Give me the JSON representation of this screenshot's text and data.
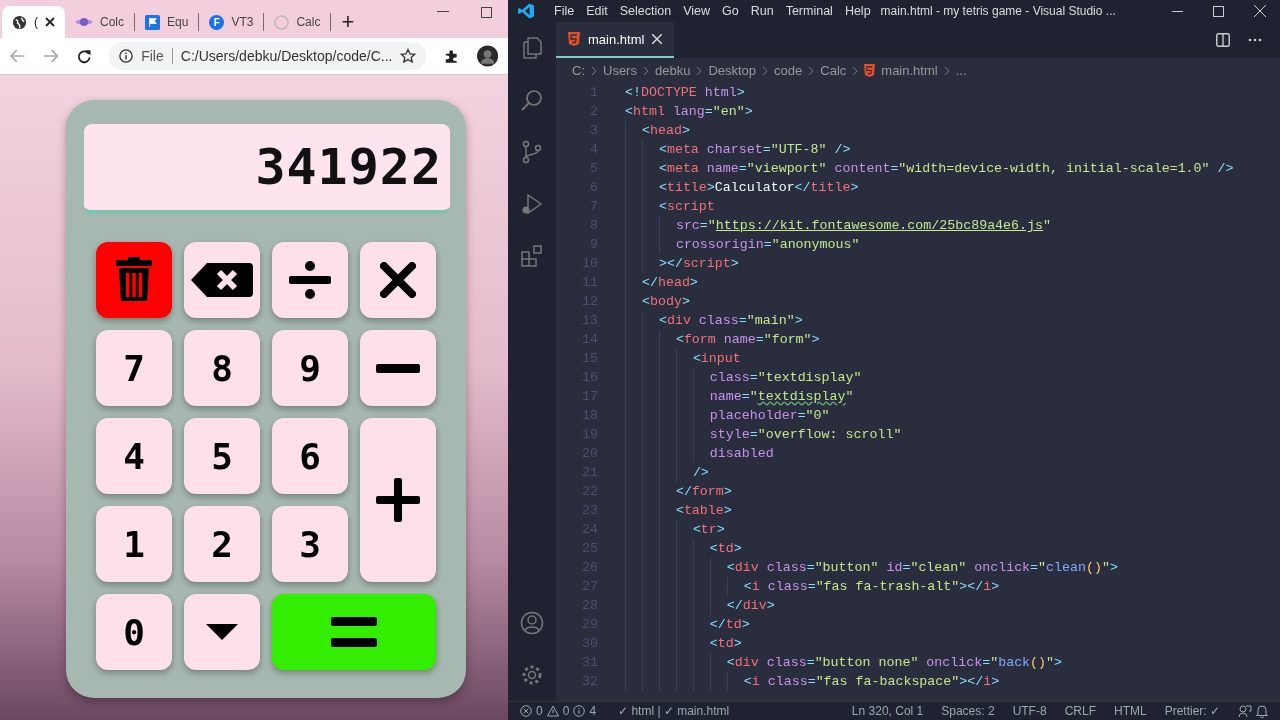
{
  "browser": {
    "tabs": [
      {
        "kind": "globe",
        "label": "(",
        "selected": true
      },
      {
        "kind": "planet",
        "label": "Colc",
        "selected": false
      },
      {
        "kind": "flag",
        "label": "Equ",
        "selected": false
      },
      {
        "kind": "letter",
        "letter": "F",
        "label": "VT3",
        "selected": false
      },
      {
        "kind": "github",
        "label": "Calc",
        "selected": false
      }
    ],
    "new_tab": "+",
    "address": {
      "scheme": "File",
      "url": "C:/Users/debku/Desktop/code/C..."
    }
  },
  "calculator": {
    "display": "341922",
    "buttons": [
      {
        "kind": "trash",
        "color": "#ff0000"
      },
      {
        "kind": "backspace",
        "color": "#fde0ea"
      },
      {
        "kind": "divide",
        "color": "#fde0ea"
      },
      {
        "kind": "times",
        "color": "#fde0ea"
      },
      {
        "kind": "digit",
        "label": "7",
        "color": "#fde0ea"
      },
      {
        "kind": "digit",
        "label": "8",
        "color": "#fde0ea"
      },
      {
        "kind": "digit",
        "label": "9",
        "color": "#fde0ea"
      },
      {
        "kind": "minus",
        "color": "#fde0ea"
      },
      {
        "kind": "digit",
        "label": "4",
        "color": "#fde0ea"
      },
      {
        "kind": "digit",
        "label": "5",
        "color": "#fde0ea"
      },
      {
        "kind": "digit",
        "label": "6",
        "color": "#fde0ea"
      },
      {
        "kind": "plus",
        "color": "#fde0ea"
      },
      {
        "kind": "digit",
        "label": "1",
        "color": "#fde0ea"
      },
      {
        "kind": "digit",
        "label": "2",
        "color": "#fde0ea"
      },
      {
        "kind": "digit",
        "label": "3",
        "color": "#fde0ea"
      },
      {
        "kind": "digit",
        "label": "0",
        "color": "#fde0ea"
      },
      {
        "kind": "caret",
        "color": "#fde0ea"
      },
      {
        "kind": "equals",
        "color": "#33ee00"
      }
    ]
  },
  "editor": {
    "menu": [
      "File",
      "Edit",
      "Selection",
      "View",
      "Go",
      "Run",
      "Terminal",
      "Help"
    ],
    "title": "main.html - my tetris game - Visual Studio ...",
    "tab": {
      "label": "main.html"
    },
    "breadcrumbs": [
      {
        "label": "C:"
      },
      {
        "label": "Users"
      },
      {
        "label": "debku"
      },
      {
        "label": "Desktop"
      },
      {
        "label": "code"
      },
      {
        "label": "Calc"
      },
      {
        "label": "main.html",
        "file": true
      },
      {
        "label": "..."
      }
    ],
    "lines": [
      {
        "n": "1",
        "tokens": [
          {
            "kind": "p",
            "text": "<!"
          },
          {
            "kind": "t",
            "text": "DOCTYPE"
          },
          {
            "kind": "a",
            "text": " html"
          },
          {
            "kind": "p",
            "text": ">"
          }
        ]
      },
      {
        "n": "2",
        "tokens": [
          {
            "kind": "p",
            "text": "<"
          },
          {
            "kind": "t",
            "text": "html"
          },
          {
            "kind": "a",
            "text": " lang"
          },
          {
            "kind": "p",
            "text": "="
          },
          {
            "kind": "s",
            "text": "\"en\""
          },
          {
            "kind": "p",
            "text": ">"
          }
        ]
      },
      {
        "n": "3",
        "tokens": [
          {
            "kind": "p",
            "text": "  <"
          },
          {
            "kind": "t",
            "text": "head"
          },
          {
            "kind": "p",
            "text": ">"
          }
        ]
      },
      {
        "n": "4",
        "tokens": [
          {
            "kind": "p",
            "text": "    <"
          },
          {
            "kind": "t",
            "text": "meta"
          },
          {
            "kind": "a",
            "text": " charset"
          },
          {
            "kind": "p",
            "text": "="
          },
          {
            "kind": "s",
            "text": "\"UTF-8\""
          },
          {
            "kind": "p",
            "text": " />"
          }
        ]
      },
      {
        "n": "5",
        "tokens": [
          {
            "kind": "p",
            "text": "    <"
          },
          {
            "kind": "t",
            "text": "meta"
          },
          {
            "kind": "a",
            "text": " name"
          },
          {
            "kind": "p",
            "text": "="
          },
          {
            "kind": "s",
            "text": "\"viewport\""
          },
          {
            "kind": "a",
            "text": " content"
          },
          {
            "kind": "p",
            "text": "="
          },
          {
            "kind": "s",
            "text": "\"width=device-width, initial-scale=1.0\""
          },
          {
            "kind": "p",
            "text": " />"
          }
        ]
      },
      {
        "n": "6",
        "tokens": [
          {
            "kind": "p",
            "text": "    <"
          },
          {
            "kind": "t",
            "text": "title"
          },
          {
            "kind": "p",
            "text": ">"
          },
          {
            "kind": "x",
            "text": "Calculator"
          },
          {
            "kind": "p",
            "text": "</"
          },
          {
            "kind": "t",
            "text": "title"
          },
          {
            "kind": "p",
            "text": ">"
          }
        ]
      },
      {
        "n": "7",
        "tokens": [
          {
            "kind": "p",
            "text": "    <"
          },
          {
            "kind": "t",
            "text": "script"
          }
        ]
      },
      {
        "n": "8",
        "tokens": [
          {
            "kind": "a",
            "text": "      src"
          },
          {
            "kind": "p",
            "text": "="
          },
          {
            "kind": "s",
            "text": "\""
          },
          {
            "kind": "l",
            "text": "https://kit.fontawesome.com/25bc89a4e6.js"
          },
          {
            "kind": "s",
            "text": "\""
          }
        ]
      },
      {
        "n": "9",
        "tokens": [
          {
            "kind": "a",
            "text": "      crossorigin"
          },
          {
            "kind": "p",
            "text": "="
          },
          {
            "kind": "s",
            "text": "\"anonymous\""
          }
        ]
      },
      {
        "n": "10",
        "tokens": [
          {
            "kind": "p",
            "text": "    ></"
          },
          {
            "kind": "t",
            "text": "script"
          },
          {
            "kind": "p",
            "text": ">"
          }
        ]
      },
      {
        "n": "11",
        "tokens": [
          {
            "kind": "p",
            "text": "  </"
          },
          {
            "kind": "t",
            "text": "head"
          },
          {
            "kind": "p",
            "text": ">"
          }
        ]
      },
      {
        "n": "12",
        "tokens": [
          {
            "kind": "p",
            "text": "  <"
          },
          {
            "kind": "t",
            "text": "body"
          },
          {
            "kind": "p",
            "text": ">"
          }
        ]
      },
      {
        "n": "13",
        "tokens": [
          {
            "kind": "p",
            "text": "    <"
          },
          {
            "kind": "t",
            "text": "div"
          },
          {
            "kind": "a",
            "text": " class"
          },
          {
            "kind": "p",
            "text": "="
          },
          {
            "kind": "s",
            "text": "\"main\""
          },
          {
            "kind": "p",
            "text": ">"
          }
        ]
      },
      {
        "n": "14",
        "tokens": [
          {
            "kind": "p",
            "text": "      <"
          },
          {
            "kind": "t",
            "text": "form"
          },
          {
            "kind": "a",
            "text": " name"
          },
          {
            "kind": "p",
            "text": "="
          },
          {
            "kind": "s",
            "text": "\"form\""
          },
          {
            "kind": "p",
            "text": ">"
          }
        ]
      },
      {
        "n": "15",
        "tokens": [
          {
            "kind": "p",
            "text": "        <"
          },
          {
            "kind": "t",
            "text": "input"
          }
        ]
      },
      {
        "n": "16",
        "tokens": [
          {
            "kind": "a",
            "text": "          class"
          },
          {
            "kind": "p",
            "text": "="
          },
          {
            "kind": "s",
            "text": "\"textdisplay\""
          }
        ]
      },
      {
        "n": "17",
        "tokens": [
          {
            "kind": "a",
            "text": "          name"
          },
          {
            "kind": "p",
            "text": "="
          },
          {
            "kind": "s",
            "text": "\""
          },
          {
            "kind": "w",
            "text": "textdisplay"
          },
          {
            "kind": "s",
            "text": "\""
          }
        ]
      },
      {
        "n": "18",
        "tokens": [
          {
            "kind": "a",
            "text": "          placeholder"
          },
          {
            "kind": "p",
            "text": "="
          },
          {
            "kind": "s",
            "text": "\"0\""
          }
        ]
      },
      {
        "n": "19",
        "tokens": [
          {
            "kind": "a",
            "text": "          style"
          },
          {
            "kind": "p",
            "text": "="
          },
          {
            "kind": "s",
            "text": "\"overflow: scroll\""
          }
        ]
      },
      {
        "n": "20",
        "tokens": [
          {
            "kind": "a",
            "text": "          disabled"
          }
        ]
      },
      {
        "n": "21",
        "tokens": [
          {
            "kind": "p",
            "text": "        />"
          }
        ]
      },
      {
        "n": "22",
        "tokens": [
          {
            "kind": "p",
            "text": "      </"
          },
          {
            "kind": "t",
            "text": "form"
          },
          {
            "kind": "p",
            "text": ">"
          }
        ]
      },
      {
        "n": "23",
        "tokens": [
          {
            "kind": "p",
            "text": "      <"
          },
          {
            "kind": "t",
            "text": "table"
          },
          {
            "kind": "p",
            "text": ">"
          }
        ]
      },
      {
        "n": "24",
        "tokens": [
          {
            "kind": "p",
            "text": "        <"
          },
          {
            "kind": "t",
            "text": "tr"
          },
          {
            "kind": "p",
            "text": ">"
          }
        ]
      },
      {
        "n": "25",
        "tokens": [
          {
            "kind": "p",
            "text": "          <"
          },
          {
            "kind": "t",
            "text": "td"
          },
          {
            "kind": "p",
            "text": ">"
          }
        ]
      },
      {
        "n": "26",
        "tokens": [
          {
            "kind": "p",
            "text": "            <"
          },
          {
            "kind": "t",
            "text": "div"
          },
          {
            "kind": "a",
            "text": " class"
          },
          {
            "kind": "p",
            "text": "="
          },
          {
            "kind": "s",
            "text": "\"button\""
          },
          {
            "kind": "a",
            "text": " id"
          },
          {
            "kind": "p",
            "text": "="
          },
          {
            "kind": "s",
            "text": "\"clean\""
          },
          {
            "kind": "a",
            "text": " onclick"
          },
          {
            "kind": "p",
            "text": "="
          },
          {
            "kind": "s",
            "text": "\""
          },
          {
            "kind": "f",
            "text": "clean"
          },
          {
            "kind": "y",
            "text": "()"
          },
          {
            "kind": "s",
            "text": "\""
          },
          {
            "kind": "p",
            "text": ">"
          }
        ]
      },
      {
        "n": "27",
        "tokens": [
          {
            "kind": "p",
            "text": "              <"
          },
          {
            "kind": "t",
            "text": "i"
          },
          {
            "kind": "a",
            "text": " class"
          },
          {
            "kind": "p",
            "text": "="
          },
          {
            "kind": "s",
            "text": "\"fas fa-trash-alt\""
          },
          {
            "kind": "p",
            "text": "></"
          },
          {
            "kind": "t",
            "text": "i"
          },
          {
            "kind": "p",
            "text": ">"
          }
        ]
      },
      {
        "n": "28",
        "tokens": [
          {
            "kind": "p",
            "text": "            </"
          },
          {
            "kind": "t",
            "text": "div"
          },
          {
            "kind": "p",
            "text": ">"
          }
        ]
      },
      {
        "n": "29",
        "tokens": [
          {
            "kind": "p",
            "text": "          </"
          },
          {
            "kind": "t",
            "text": "td"
          },
          {
            "kind": "p",
            "text": ">"
          }
        ]
      },
      {
        "n": "30",
        "tokens": [
          {
            "kind": "p",
            "text": "          <"
          },
          {
            "kind": "t",
            "text": "td"
          },
          {
            "kind": "p",
            "text": ">"
          }
        ]
      },
      {
        "n": "31",
        "tokens": [
          {
            "kind": "p",
            "text": "            <"
          },
          {
            "kind": "t",
            "text": "div"
          },
          {
            "kind": "a",
            "text": " class"
          },
          {
            "kind": "p",
            "text": "="
          },
          {
            "kind": "s",
            "text": "\"button none\""
          },
          {
            "kind": "a",
            "text": " onclick"
          },
          {
            "kind": "p",
            "text": "="
          },
          {
            "kind": "s",
            "text": "\""
          },
          {
            "kind": "f",
            "text": "back"
          },
          {
            "kind": "y",
            "text": "()"
          },
          {
            "kind": "s",
            "text": "\""
          },
          {
            "kind": "p",
            "text": ">"
          }
        ]
      },
      {
        "n": "32",
        "tokens": [
          {
            "kind": "p",
            "text": "              <"
          },
          {
            "kind": "t",
            "text": "i"
          },
          {
            "kind": "a",
            "text": " class"
          },
          {
            "kind": "p",
            "text": "="
          },
          {
            "kind": "s",
            "text": "\"fas fa-backspace\""
          },
          {
            "kind": "p",
            "text": "></"
          },
          {
            "kind": "t",
            "text": "i"
          },
          {
            "kind": "p",
            "text": ">"
          }
        ]
      }
    ],
    "status": {
      "errors": "0",
      "warnings": "0",
      "infos": "4",
      "left": "✓ html | ✓ main.html",
      "right": [
        "Ln 320, Col 1",
        "Spaces: 2",
        "UTF-8",
        "CRLF",
        "HTML",
        "Prettier: ✓"
      ]
    }
  }
}
